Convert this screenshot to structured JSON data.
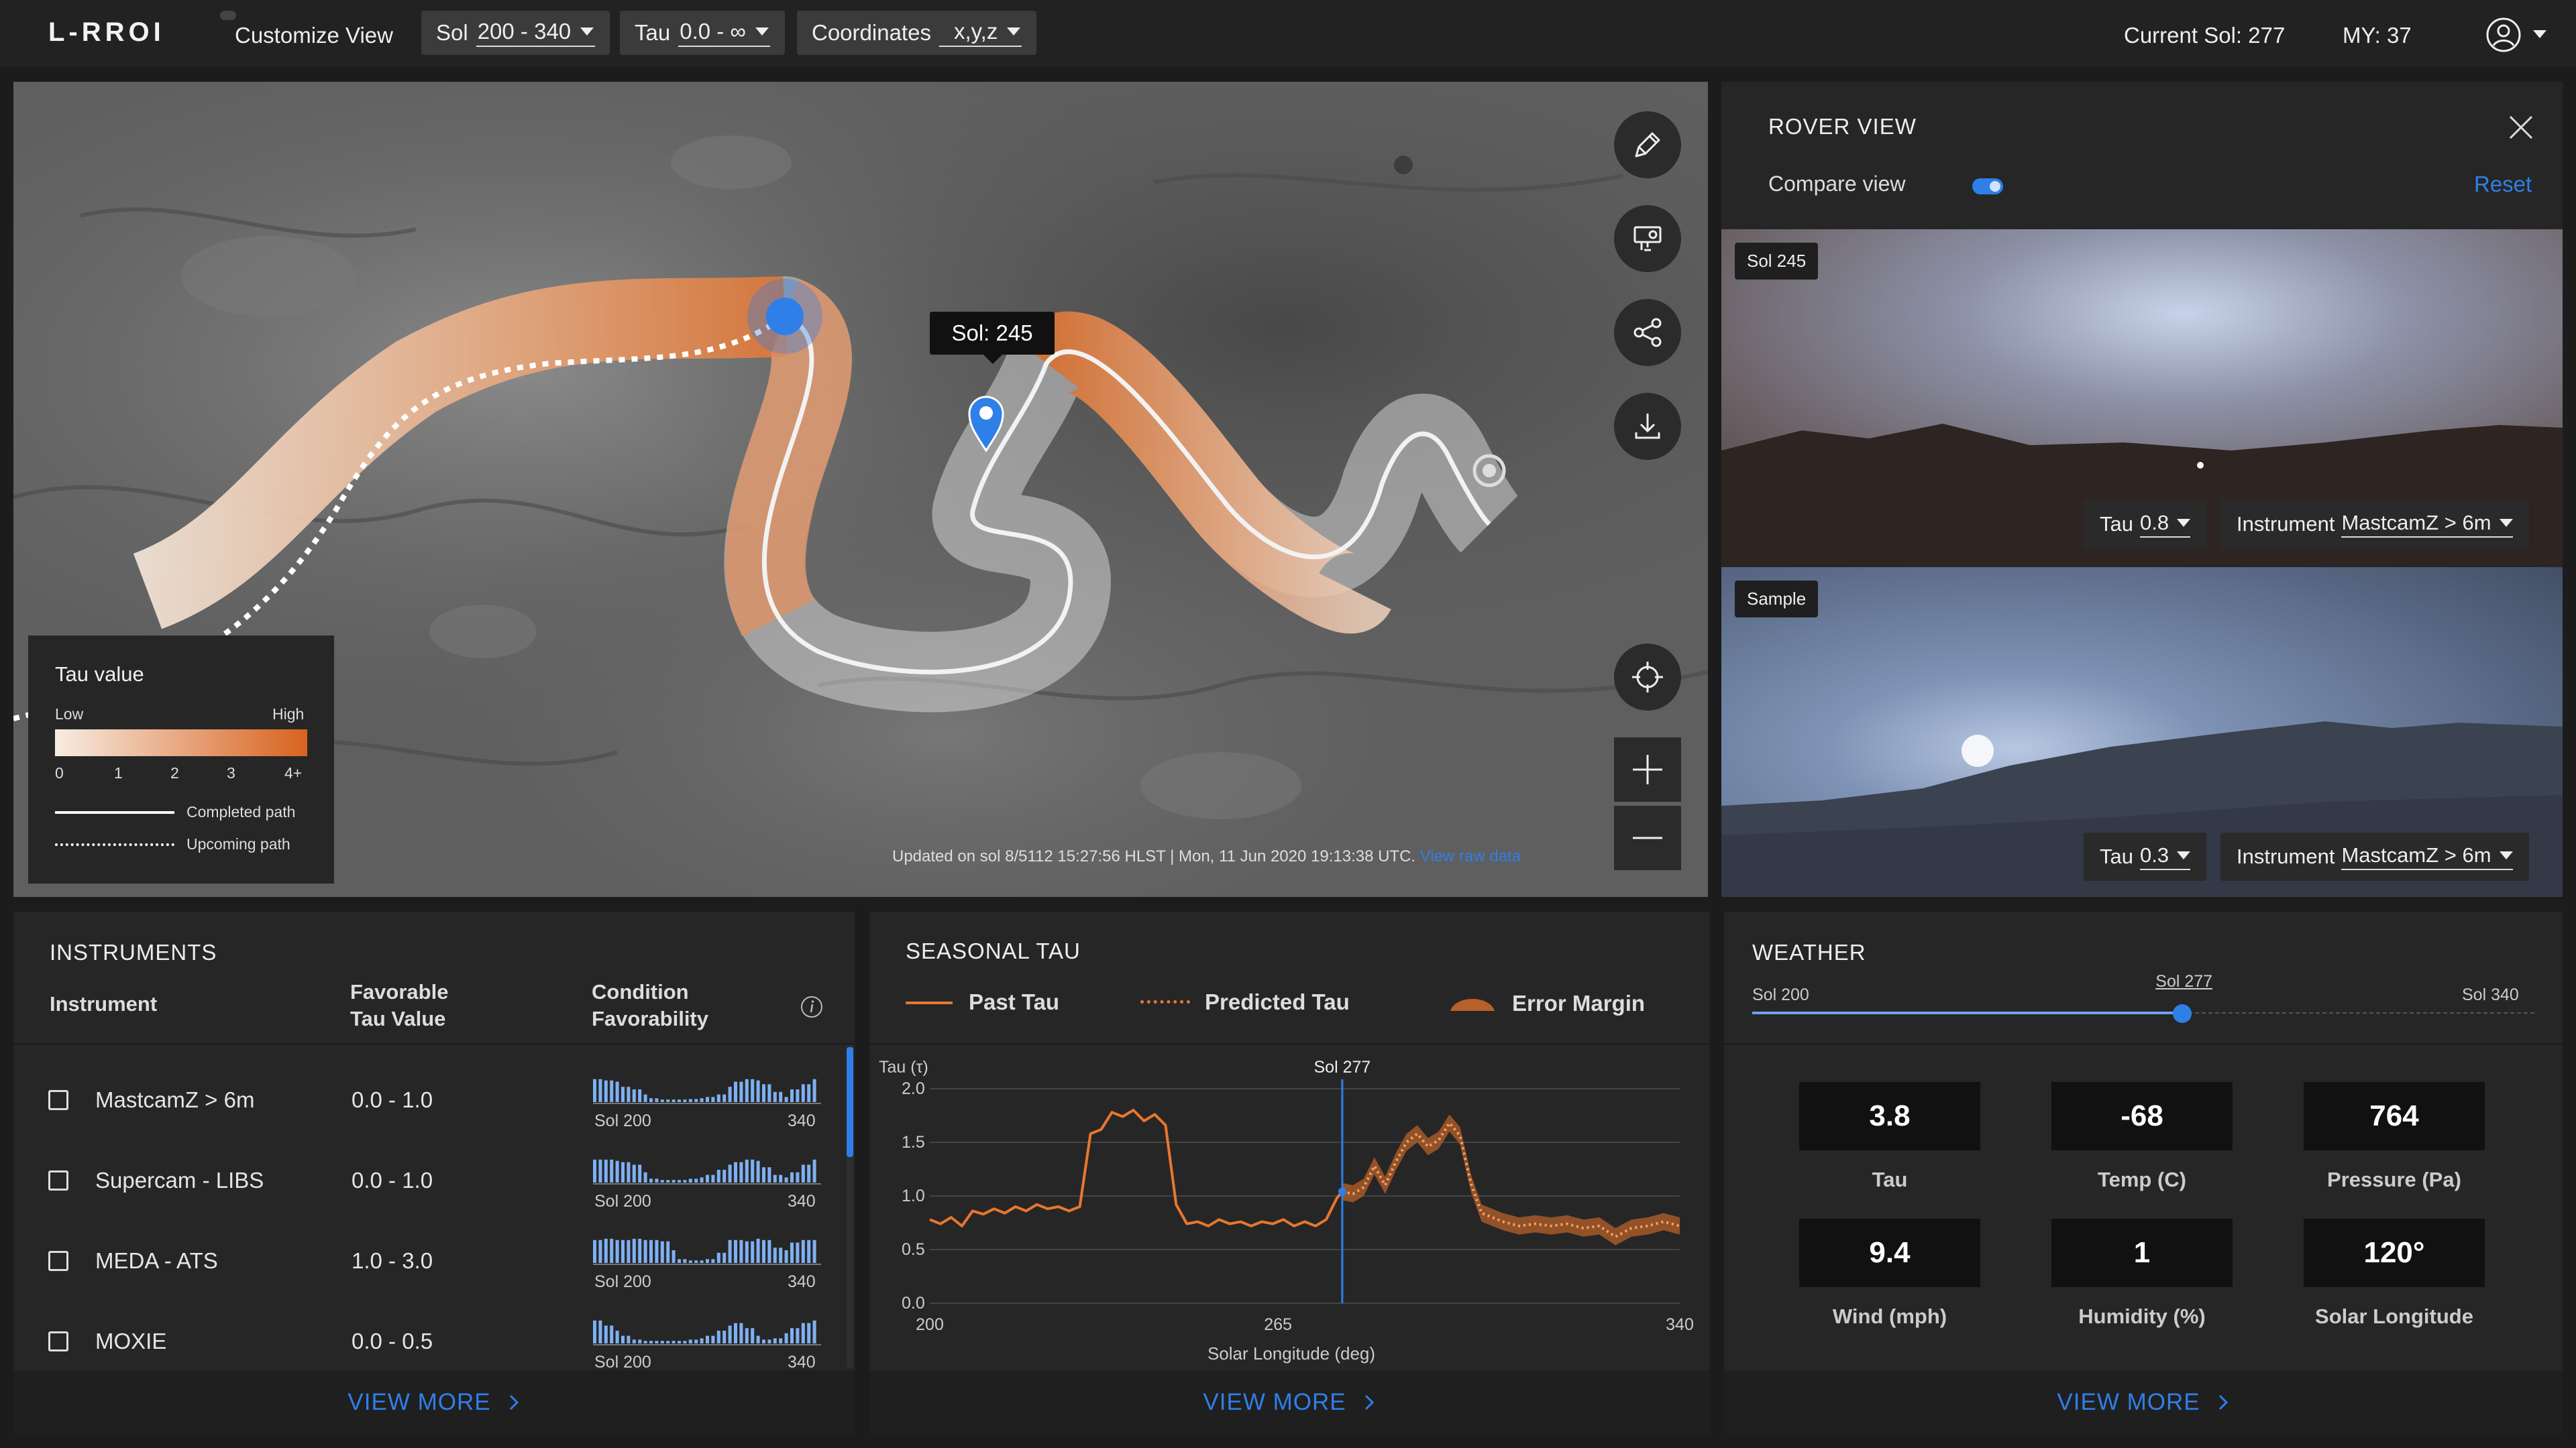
{
  "topbar": {
    "logo": "L-RROI",
    "customize": "Customize View",
    "sol_label": "Sol",
    "sol_value": "200 - 340",
    "tau_label": "Tau",
    "tau_value": "0.0 - ∞",
    "coord_label": "Coordinates",
    "coord_value": "x,y,z",
    "current_sol": "Current Sol: 277",
    "my": "MY:  37"
  },
  "map": {
    "tooltip": "Sol: 245",
    "updated": "Updated on sol 8/5112 15:27:56 HLST | Mon, 11 Jun 2020 19:13:38 UTC.",
    "updated_link": "View raw data",
    "tools": [
      "pen-tool-icon",
      "projector-icon",
      "share-icon",
      "download-icon",
      "crosshair-icon",
      "zoom-in-icon",
      "zoom-out-icon"
    ],
    "legend": {
      "title": "Tau value",
      "low": "Low",
      "high": "High",
      "ticks": [
        "0",
        "1",
        "2",
        "3",
        "4+"
      ],
      "completed": "Completed path",
      "upcoming": "Upcoming path"
    }
  },
  "rover": {
    "title": "ROVER VIEW",
    "compare": "Compare view",
    "compare_on": true,
    "reset": "Reset",
    "top": {
      "tag": "Sol 245",
      "tau_label": "Tau",
      "tau_value": "0.8",
      "inst_label": "Instrument",
      "inst_value": "MastcamZ  > 6m"
    },
    "bottom": {
      "tag": "Sample",
      "tau_label": "Tau",
      "tau_value": "0.3",
      "inst_label": "Instrument",
      "inst_value": "MastcamZ  > 6m"
    }
  },
  "instruments": {
    "title": "INSTRUMENTS",
    "col_instrument": "Instrument",
    "col_fav1": "Favorable",
    "col_fav2": "Tau Value",
    "col_cond1": "Condition",
    "col_cond2": "Favorability",
    "rows": [
      {
        "name": "MastcamZ > 6m",
        "range": "0.0 - 1.0",
        "sol_start": "Sol 200",
        "sol_end": "340"
      },
      {
        "name": "Supercam - LIBS",
        "range": "0.0 - 1.0",
        "sol_start": "Sol 200",
        "sol_end": "340"
      },
      {
        "name": "MEDA - ATS",
        "range": "1.0 - 3.0",
        "sol_start": "Sol 200",
        "sol_end": "340"
      },
      {
        "name": "MOXIE",
        "range": "0.0 - 0.5",
        "sol_start": "Sol 200",
        "sol_end": "340"
      }
    ],
    "view_more": "VIEW MORE"
  },
  "seasonal": {
    "title": "SEASONAL TAU",
    "legend_past": "Past Tau",
    "legend_pred": "Predicted Tau",
    "legend_err": "Error Margin",
    "view_more": "VIEW MORE"
  },
  "chart_data": {
    "type": "line",
    "ylabel": "Tau (τ)",
    "xlabel": "Solar Longitude (deg)",
    "xlim": [
      200,
      340
    ],
    "ylim": [
      0.0,
      2.0
    ],
    "x_ticks": [
      "200",
      "265",
      "340"
    ],
    "y_ticks": [
      "0.0",
      "0.5",
      "1.0",
      "1.5",
      "2.0"
    ],
    "marker_label": "Sol 277",
    "marker_x": 277,
    "colors": {
      "past": "#e8772e",
      "predicted": "#e8772e",
      "error": "#b8602a",
      "marker": "#2f7fe8"
    },
    "series": [
      {
        "name": "Past Tau",
        "x": [
          200,
          202,
          204,
          206,
          208,
          210,
          212,
          214,
          216,
          218,
          220,
          222,
          224,
          226,
          228,
          230,
          232,
          234,
          236,
          238,
          240,
          242,
          244,
          246,
          248,
          250,
          252,
          254,
          256,
          258,
          260,
          262,
          264,
          266,
          268,
          270,
          272,
          274,
          276,
          277
        ],
        "y": [
          0.78,
          0.74,
          0.8,
          0.72,
          0.86,
          0.83,
          0.88,
          0.84,
          0.9,
          0.86,
          0.92,
          0.88,
          0.9,
          0.86,
          0.9,
          1.58,
          1.62,
          1.78,
          1.74,
          1.8,
          1.7,
          1.76,
          1.66,
          0.92,
          0.74,
          0.76,
          0.72,
          0.78,
          0.74,
          0.76,
          0.72,
          0.76,
          0.74,
          0.78,
          0.72,
          0.76,
          0.72,
          0.78,
          0.98,
          1.04
        ]
      },
      {
        "name": "Predicted Tau",
        "x": [
          277,
          279,
          281,
          283,
          285,
          287,
          289,
          291,
          293,
          295,
          297,
          299,
          301,
          303,
          305,
          307,
          310,
          313,
          316,
          319,
          322,
          325,
          328,
          331,
          334,
          337,
          340
        ],
        "y": [
          1.04,
          1.02,
          1.08,
          1.28,
          1.1,
          1.32,
          1.5,
          1.58,
          1.46,
          1.52,
          1.68,
          1.56,
          1.12,
          0.84,
          0.8,
          0.76,
          0.72,
          0.74,
          0.72,
          0.74,
          0.7,
          0.72,
          0.62,
          0.7,
          0.72,
          0.76,
          0.72
        ]
      }
    ]
  },
  "weather": {
    "title": "WEATHER",
    "slider_start": "Sol 200",
    "slider_end": "Sol 340",
    "slider_current": "Sol 277",
    "slider_fraction": 0.55,
    "cards": [
      {
        "value": "3.8",
        "label": "Tau"
      },
      {
        "value": "-68",
        "label": "Temp (C)"
      },
      {
        "value": "764",
        "label": "Pressure (Pa)"
      },
      {
        "value": "9.4",
        "label": "Wind (mph)"
      },
      {
        "value": "1",
        "label": "Humidity (%)"
      },
      {
        "value": "120°",
        "label": "Solar Longitude"
      }
    ],
    "view_more": "VIEW MORE"
  }
}
